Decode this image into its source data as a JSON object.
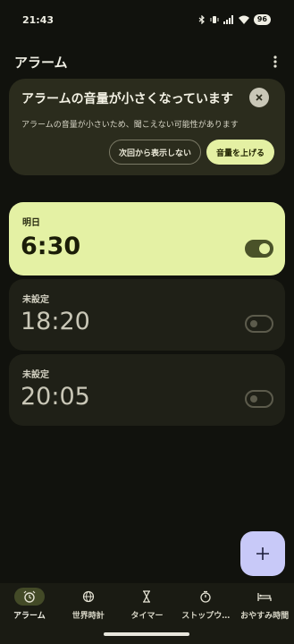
{
  "status_bar": {
    "time": "21:43",
    "battery": "96"
  },
  "app_bar": {
    "title": "アラーム",
    "more_icon": "more-vert-icon"
  },
  "banner": {
    "title": "アラームの音量が小さくなっています",
    "body": "アラームの音量が小さいため、聞こえない可能性があります",
    "dismiss_label": "次回から表示しない",
    "action_label": "音量を上げる"
  },
  "alarms": [
    {
      "day": "明日",
      "time": "6:30",
      "enabled": true
    },
    {
      "day": "未設定",
      "time": "18:20",
      "enabled": false
    },
    {
      "day": "未設定",
      "time": "20:05",
      "enabled": false
    }
  ],
  "fab": {
    "icon": "add-icon"
  },
  "nav": [
    {
      "label": "アラーム",
      "icon": "alarm-icon",
      "selected": true
    },
    {
      "label": "世界時計",
      "icon": "globe-icon",
      "selected": false
    },
    {
      "label": "タイマー",
      "icon": "hourglass-icon",
      "selected": false
    },
    {
      "label": "ストップウ…",
      "icon": "stopwatch-icon",
      "selected": false
    },
    {
      "label": "おやすみ時間",
      "icon": "bed-icon",
      "selected": false
    }
  ],
  "colors": {
    "background": "#11120d",
    "active_card": "#e4f1a4",
    "banner": "#2b2c1d",
    "fab": "#c8c9f8"
  }
}
